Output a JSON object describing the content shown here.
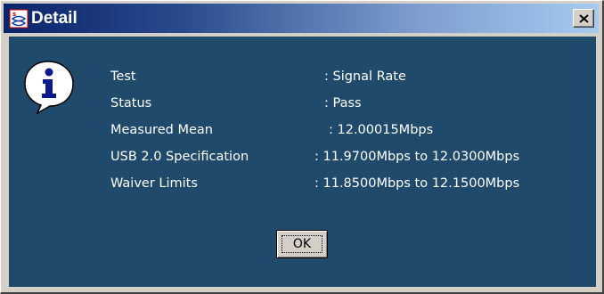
{
  "window": {
    "title": "Detail",
    "app_icon": "application-logo-icon",
    "close_icon": "close-icon"
  },
  "colors": {
    "content_background": "#1f4a6b",
    "title_gradient_start": "#0a246a",
    "title_gradient_end": "#a6caf0",
    "text": "#ffffff"
  },
  "dialog": {
    "icon": "info-icon",
    "rows": [
      {
        "label": "Test",
        "value": ": Signal Rate"
      },
      {
        "label": "Status",
        "value": ": Pass"
      },
      {
        "label": "Measured Mean",
        "value": ": 12.00015Mbps"
      },
      {
        "label": "USB 2.0 Specification",
        "value": ": 11.9700Mbps to 12.0300Mbps"
      },
      {
        "label": "Waiver Limits",
        "value": ": 11.8500Mbps to 12.1500Mbps"
      }
    ],
    "ok_label": "OK"
  }
}
